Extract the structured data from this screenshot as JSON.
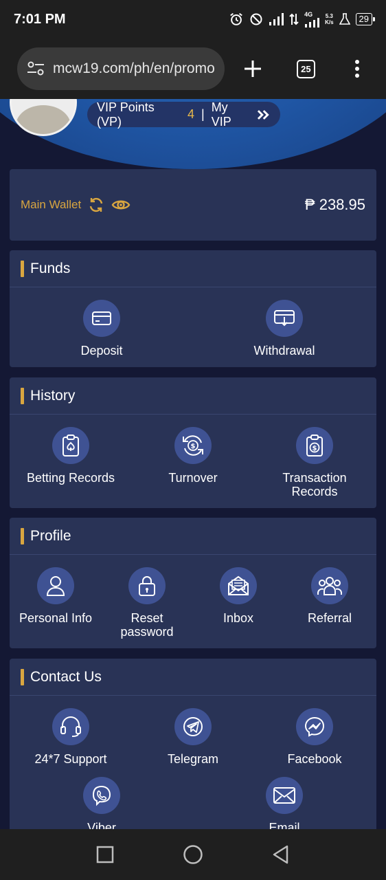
{
  "status": {
    "time": "7:01 PM",
    "net_speed_value": "5.3",
    "net_speed_unit": "K/s",
    "network_type": "4G",
    "battery": "29"
  },
  "browser": {
    "url": "mcw19.com/ph/en/promo",
    "tab_count": "25"
  },
  "vip": {
    "points_label": "VIP Points (VP)",
    "points_value": "4",
    "separator": "|",
    "my_vip_label": "My VIP"
  },
  "wallet": {
    "label": "Main Wallet",
    "amount": "₱ 238.95"
  },
  "funds": {
    "title": "Funds",
    "items": [
      {
        "label": "Deposit",
        "icon": "card-icon"
      },
      {
        "label": "Withdrawal",
        "icon": "withdraw-icon"
      }
    ]
  },
  "history": {
    "title": "History",
    "items": [
      {
        "label": "Betting Records",
        "icon": "betting-icon"
      },
      {
        "label": "Turnover",
        "icon": "turnover-icon"
      },
      {
        "label1": "Transaction",
        "label2": "Records",
        "icon": "transaction-icon"
      }
    ]
  },
  "profile": {
    "title": "Profile",
    "items": [
      {
        "label": "Personal Info",
        "icon": "user-icon"
      },
      {
        "label1": "Reset",
        "label2": "password",
        "icon": "lock-icon"
      },
      {
        "label": "Inbox",
        "icon": "mail-open-icon"
      },
      {
        "label": "Referral",
        "icon": "group-icon"
      }
    ]
  },
  "contact": {
    "title": "Contact Us",
    "items": [
      {
        "label": "24*7 Support",
        "icon": "headset-icon"
      },
      {
        "label": "Telegram",
        "icon": "telegram-icon"
      },
      {
        "label": "Facebook",
        "icon": "messenger-icon"
      },
      {
        "label": "Viber",
        "icon": "viber-icon"
      },
      {
        "label": "Email",
        "icon": "email-icon"
      }
    ]
  },
  "colors": {
    "accent_gold": "#d9a640",
    "card_bg": "#293356",
    "icon_circle": "#3f5293",
    "page_bg": "#141834"
  }
}
